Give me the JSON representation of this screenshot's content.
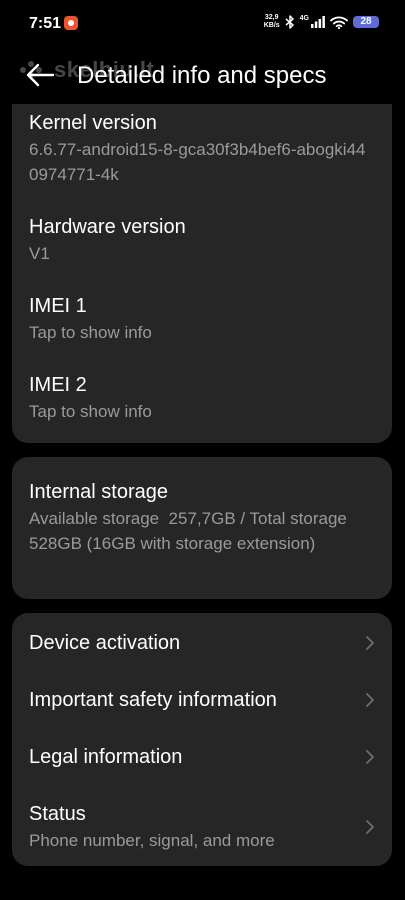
{
  "status_bar": {
    "time": "7:51",
    "net_speed_value": "32,9",
    "net_speed_unit": "KB/s",
    "net_type": "4G",
    "battery": "28"
  },
  "header": {
    "title": "Detailed info and specs",
    "watermark_text": "skelbiu.lt"
  },
  "specs": {
    "kernel": {
      "label": "Kernel version",
      "value": "6.6.77-android15-8-gca30f3b4bef6-abogki440974771-4k"
    },
    "hardware": {
      "label": "Hardware version",
      "value": "V1"
    },
    "imei1": {
      "label": "IMEI 1",
      "value": "Tap to show info"
    },
    "imei2": {
      "label": "IMEI 2",
      "value": "Tap to show info"
    }
  },
  "storage": {
    "label": "Internal storage",
    "value": "Available storage  257,7GB / Total storage  528GB (16GB with storage extension)"
  },
  "menu": {
    "device_activation": "Device activation",
    "safety_info": "Important safety information",
    "legal_info": "Legal information",
    "status": {
      "label": "Status",
      "sub": "Phone number, signal, and more"
    }
  },
  "colors": {
    "background": "#000000",
    "card": "#262626",
    "secondary_text": "#9a9a9a",
    "battery_accent": "#5e6bd8",
    "notification_icon": "#f0542d"
  }
}
